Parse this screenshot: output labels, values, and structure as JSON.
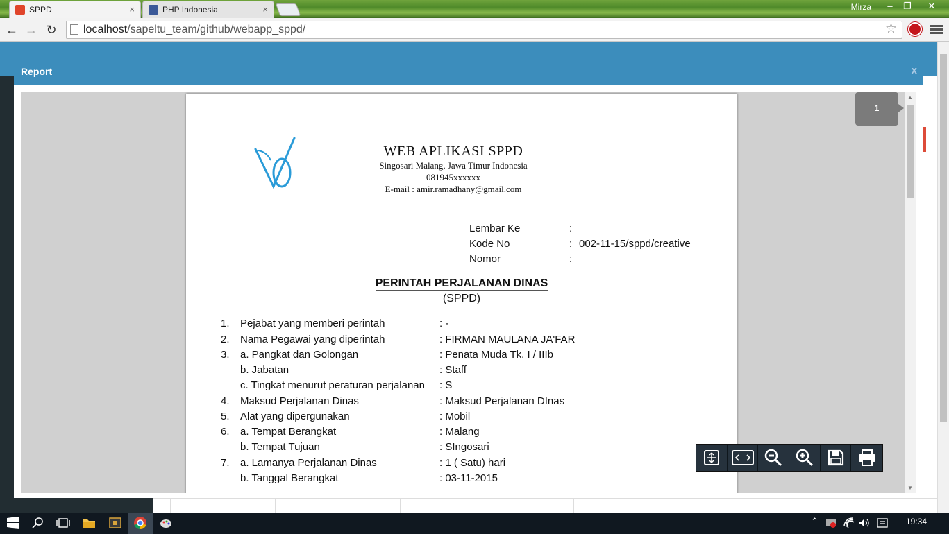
{
  "browser": {
    "tabs": [
      {
        "label": "SPPD",
        "close": "×",
        "favicon_color": "#e0452b"
      },
      {
        "label": "PHP Indonesia",
        "close": "×",
        "favicon_color": "#3b5998"
      }
    ],
    "user": "Mirza",
    "window_controls": {
      "minimize": "–",
      "maximize": "❐",
      "close": "✕"
    },
    "url_host": "localhost",
    "url_path": "/sapeltu_team/github/webapp_sppd/",
    "back_icon": "←",
    "forward_icon": "→",
    "reload_icon": "↻",
    "star_icon": "☆"
  },
  "modal": {
    "title": "Report",
    "close": "x",
    "page_indicator": "1"
  },
  "document": {
    "org_name": "WEB APLIKASI SPPD",
    "org_address": "Singosari Malang, Jawa Timur Indonesia",
    "org_phone": "081945xxxxxx",
    "org_email": "E-mail : amir.ramadhany@gmail.com",
    "meta": [
      {
        "label": "Lembar Ke",
        "sep": ":",
        "value": ""
      },
      {
        "label": "Kode No",
        "sep": ":",
        "value": "002-11-15/sppd/creative"
      },
      {
        "label": "Nomor",
        "sep": ":",
        "value": ""
      }
    ],
    "title": "PERINTAH PERJALANAN DINAS",
    "subtitle": "(SPPD)",
    "rows": [
      {
        "num": "1.",
        "label": "Pejabat yang memberi perintah",
        "value": ": -"
      },
      {
        "num": "2.",
        "label": "Nama Pegawai yang diperintah",
        "value": ": FIRMAN MAULANA JA'FAR"
      },
      {
        "num": "3.",
        "label": "a. Pangkat dan Golongan",
        "value": ": Penata Muda Tk. I / IIIb"
      },
      {
        "num": "",
        "label": "b. Jabatan",
        "value": ": Staff"
      },
      {
        "num": "",
        "label": "c. Tingkat menurut peraturan perjalanan",
        "value": ": S"
      },
      {
        "num": "4.",
        "label": "Maksud Perjalanan Dinas",
        "value": ": Maksud Perjalanan DInas"
      },
      {
        "num": "5.",
        "label": "Alat yang dipergunakan",
        "value": ": Mobil"
      },
      {
        "num": "6.",
        "label": "a. Tempat Berangkat",
        "value": ": Malang"
      },
      {
        "num": "",
        "label": "b. Tempat Tujuan",
        "value": ": SIngosari"
      },
      {
        "num": "7.",
        "label": "a. Lamanya Perjalanan Dinas",
        "value": ": 1 ( Satu) hari"
      },
      {
        "num": "",
        "label": "b. Tanggal Berangkat",
        "value": ": 03-11-2015"
      }
    ]
  },
  "pdf_toolbar": [
    "fit-page-icon",
    "fit-width-icon",
    "zoom-out-icon",
    "zoom-in-icon",
    "save-icon",
    "print-icon"
  ],
  "taskbar": {
    "clock": "19:34"
  }
}
